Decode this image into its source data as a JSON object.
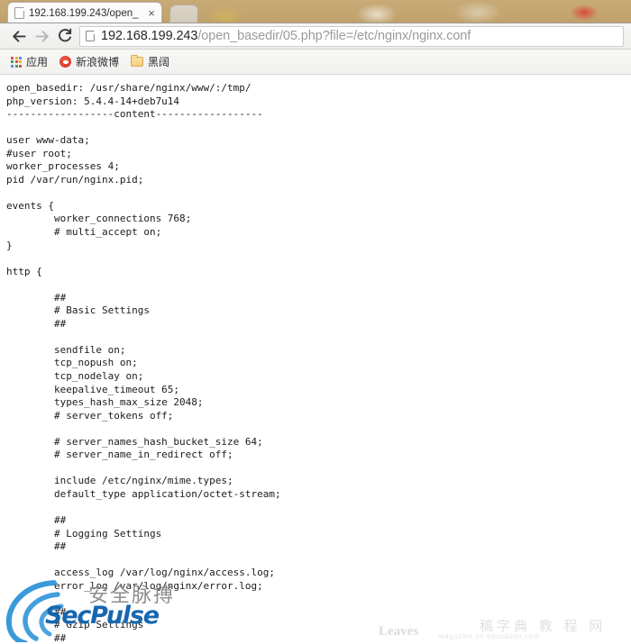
{
  "browser": {
    "tab": {
      "title": "192.168.199.243/open_",
      "close_label": "×",
      "favicon": "page-icon"
    },
    "newtab_label": "",
    "toolbar": {
      "back_label": "Back",
      "forward_label": "Forward",
      "reload_label": "Reload",
      "url_host": "192.168.199.243",
      "url_path": "/open_basedir/05.php?file=/etc/nginx/nginx.conf",
      "url_full": "192.168.199.243/open_basedir/05.php?file=/etc/nginx/nginx.conf"
    },
    "bookmarks": [
      {
        "label": "应用",
        "icon": "apps-grid-icon"
      },
      {
        "label": "新浪微博",
        "icon": "weibo-icon"
      },
      {
        "label": "黑阔",
        "icon": "folder-icon"
      }
    ]
  },
  "page": {
    "content": "open_basedir: /usr/share/nginx/www/:/tmp/\nphp_version: 5.4.4-14+deb7u14\n------------------content------------------\n\nuser www-data;\n#user root;\nworker_processes 4;\npid /var/run/nginx.pid;\n\nevents {\n        worker_connections 768;\n        # multi_accept on;\n}\n\nhttp {\n\n        ##\n        # Basic Settings\n        ##\n\n        sendfile on;\n        tcp_nopush on;\n        tcp_nodelay on;\n        keepalive_timeout 65;\n        types_hash_max_size 2048;\n        # server_tokens off;\n\n        # server_names_hash_bucket_size 64;\n        # server_name_in_redirect off;\n\n        include /etc/nginx/mime.types;\n        default_type application/octet-stream;\n\n        ##\n        # Logging Settings\n        ##\n\n        access_log /var/log/nginx/access.log;\n        error_log /var/log/nginx/error.log;\n\n        ##\n        # Gzip Settings\n        ##",
    "fields": {
      "open_basedir_label": "open_basedir:",
      "open_basedir_value": "/usr/share/nginx/www/:/tmp/",
      "php_version_label": "php_version:",
      "php_version_value": "5.4.4-14+deb7u14",
      "separator": "------------------content------------------"
    }
  },
  "watermarks": {
    "secpulse": {
      "chinese": "安全脉搏",
      "brand": "SecPulse",
      "color": "#1667b0"
    },
    "bottom_right": {
      "leaves": "Leaves",
      "chinese": "稿字典 教 程 网",
      "sub": "magazine.cn·education.com"
    }
  },
  "colors": {
    "tabstrip_bg": "#c4a671",
    "toolbar_bg": "#f2f2f0",
    "url_host_text": "#242424",
    "url_path_text": "#9b9b9b",
    "page_text": "#1b1b1b",
    "brand_blue": "#1667b0"
  }
}
